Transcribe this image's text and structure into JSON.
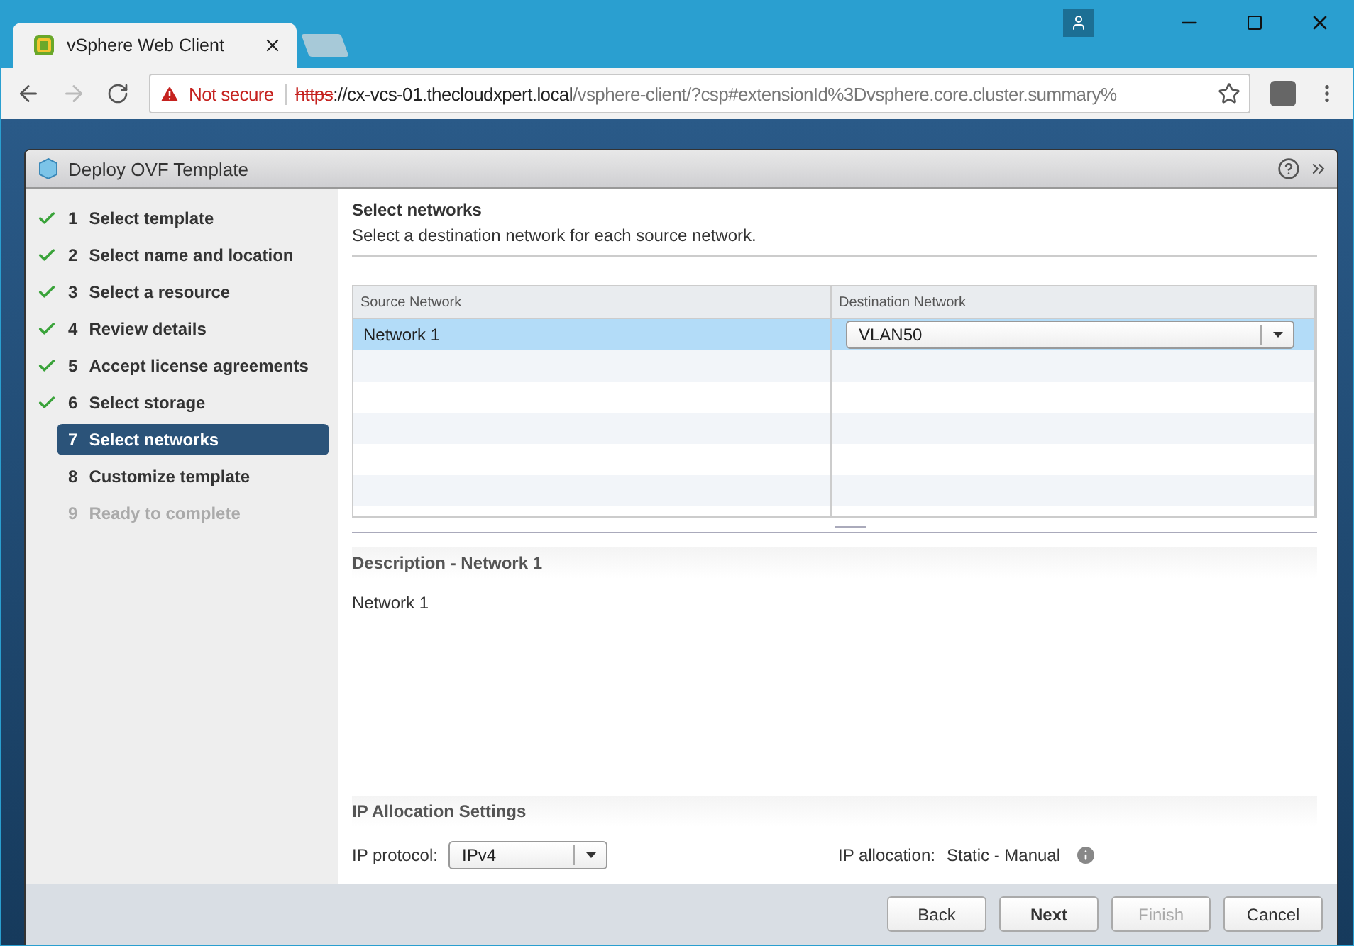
{
  "browser": {
    "tab_title": "vSphere Web Client",
    "security": "Not secure",
    "url_scheme": "https",
    "url_host": "://cx-vcs-01.thecloudxpert.local",
    "url_path": "/vsphere-client/?csp#extensionId%3Dvsphere.core.cluster.summary%"
  },
  "dialog": {
    "title": "Deploy OVF Template"
  },
  "steps": [
    {
      "number": "1",
      "label": "Select template",
      "done": true,
      "selected": false,
      "disabled": false
    },
    {
      "number": "2",
      "label": "Select name and location",
      "done": true,
      "selected": false,
      "disabled": false
    },
    {
      "number": "3",
      "label": "Select a resource",
      "done": true,
      "selected": false,
      "disabled": false
    },
    {
      "number": "4",
      "label": "Review details",
      "done": true,
      "selected": false,
      "disabled": false
    },
    {
      "number": "5",
      "label": "Accept license agreements",
      "done": true,
      "selected": false,
      "disabled": false
    },
    {
      "number": "6",
      "label": "Select storage",
      "done": true,
      "selected": false,
      "disabled": false
    },
    {
      "number": "7",
      "label": "Select networks",
      "done": false,
      "selected": true,
      "disabled": false
    },
    {
      "number": "8",
      "label": "Customize template",
      "done": false,
      "selected": false,
      "disabled": false
    },
    {
      "number": "9",
      "label": "Ready to complete",
      "done": false,
      "selected": false,
      "disabled": true
    }
  ],
  "page": {
    "title": "Select networks",
    "subtitle": "Select a destination network for each source network."
  },
  "table": {
    "columns": [
      "Source Network",
      "Destination Network"
    ],
    "rows": [
      {
        "source": "Network 1",
        "destination": "VLAN50",
        "selected": true
      }
    ]
  },
  "description": {
    "title": "Description - Network 1",
    "text": "Network 1"
  },
  "ip_settings": {
    "title": "IP Allocation Settings",
    "protocol_label": "IP protocol:",
    "protocol_value": "IPv4",
    "allocation_label": "IP allocation:",
    "allocation_value": "Static - Manual"
  },
  "buttons": [
    {
      "label": "Back",
      "primary": false,
      "disabled": false
    },
    {
      "label": "Next",
      "primary": true,
      "disabled": false
    },
    {
      "label": "Finish",
      "primary": false,
      "disabled": true
    },
    {
      "label": "Cancel",
      "primary": false,
      "disabled": false
    }
  ]
}
